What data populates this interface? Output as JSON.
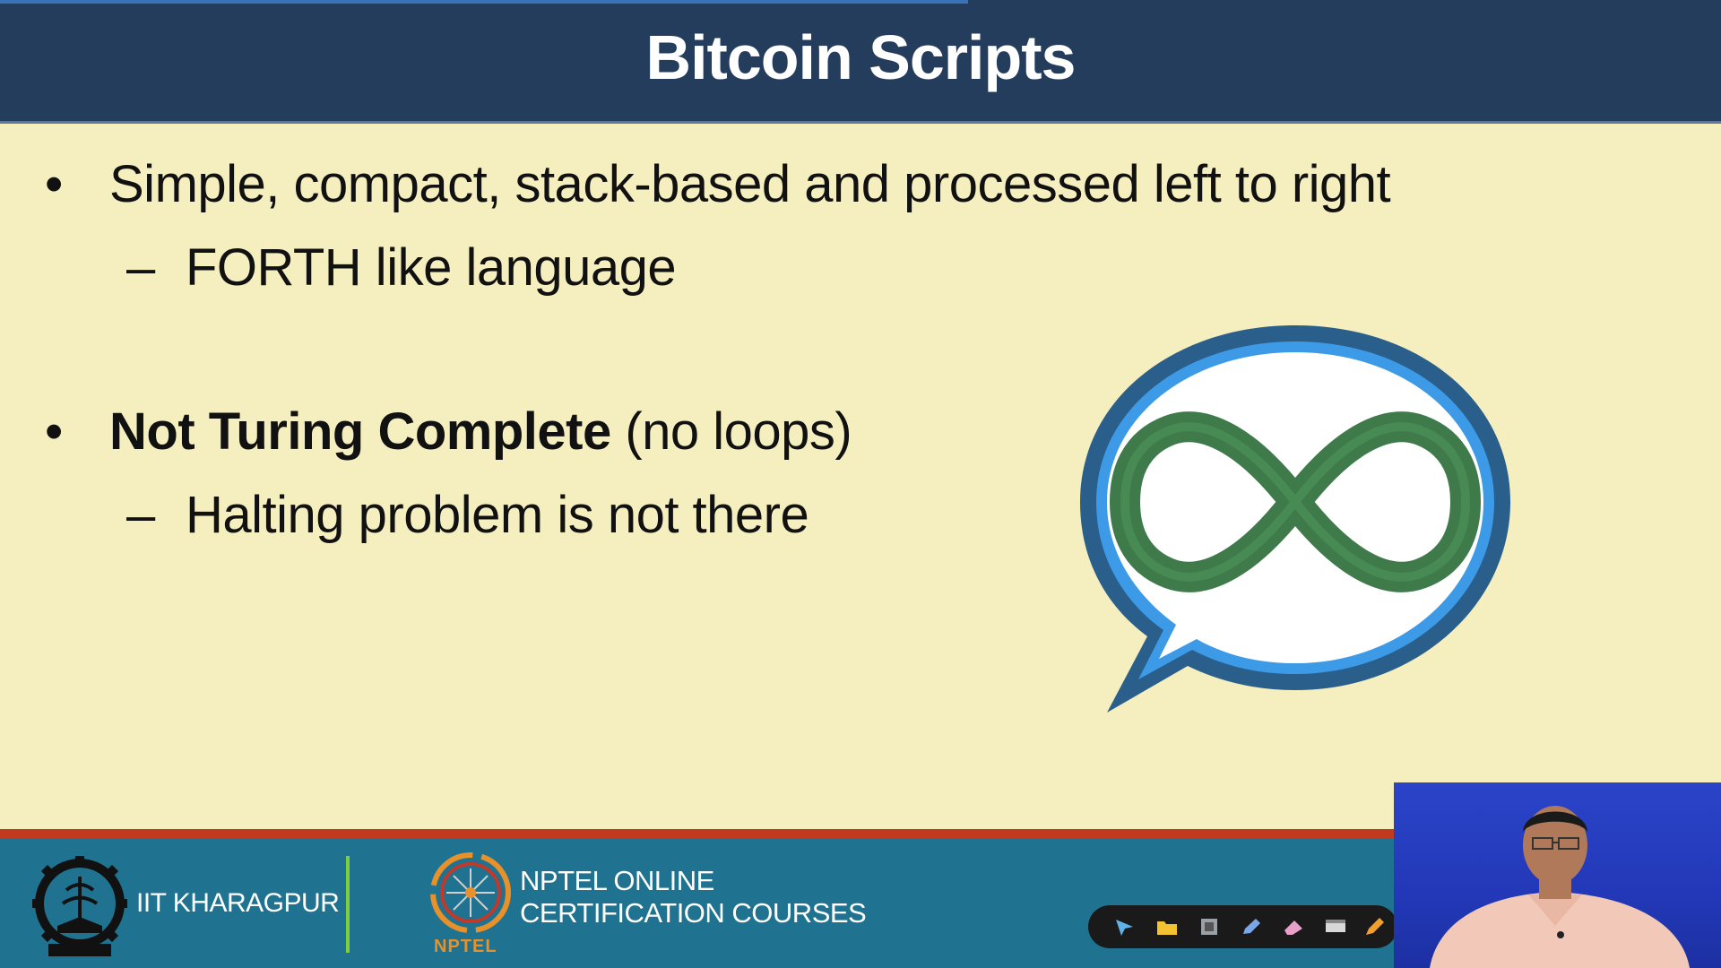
{
  "slide": {
    "title": "Bitcoin Scripts",
    "bullets": [
      {
        "marker": "•",
        "text": "Simple, compact, stack-based and processed left to right",
        "subs": [
          {
            "marker": "–",
            "text": "FORTH like language"
          }
        ]
      },
      {
        "marker": "•",
        "bold_text": "Not Turing Complete",
        "text": " (no loops)",
        "subs": [
          {
            "marker": "–",
            "text": "Halting problem is not there"
          }
        ]
      }
    ],
    "illustration": "infinity-speech-bubble-icon"
  },
  "footer": {
    "institute": "IIT KHARAGPUR",
    "nptel_label": "NPTEL",
    "nptel_line1": "NPTEL ONLINE",
    "nptel_line2": "CERTIFICATION COURSES",
    "toolbar_tools": [
      "pointer-icon",
      "folder-icon",
      "film-icon",
      "pen-icon",
      "eraser-icon",
      "board-icon",
      "pencil-icon"
    ]
  },
  "colors": {
    "title_bar": "#253d5c",
    "background": "#f5eebf",
    "footer": "#1f7391",
    "accent_red": "#c23a1e",
    "accent_green": "#7fce3e",
    "infinity_green": "#3f7a4a",
    "bubble_blue": "#2f6fae"
  }
}
